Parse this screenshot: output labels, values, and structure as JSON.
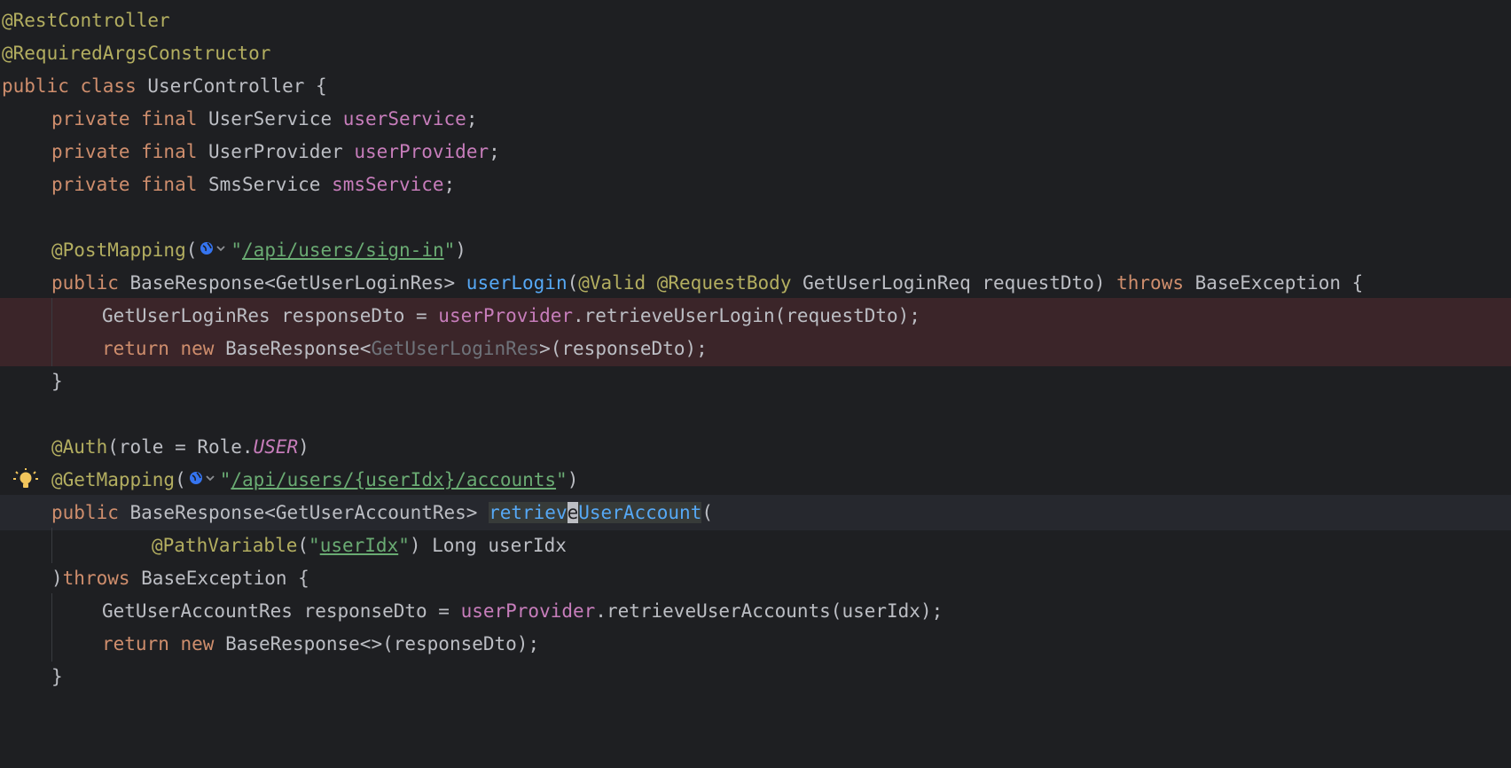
{
  "editor": {
    "colors": {
      "background": "#1e1f22",
      "highlight_line": "#3b2529",
      "keyword": "#cf8e6d",
      "annotation": "#b3ae60",
      "field": "#c77dbb",
      "method": "#56a8f5",
      "string": "#6aab73"
    },
    "code": {
      "l1_ann": "@RestController",
      "l2_ann": "@RequiredArgsConstructor",
      "l3_kw": "public class",
      "l3_rest": " UserController {",
      "l4_kw": "private final",
      "l4_type": " UserService ",
      "l4_field": "userService",
      "l4_end": ";",
      "l5_kw": "private final",
      "l5_type": " UserProvider ",
      "l5_field": "userProvider",
      "l5_end": ";",
      "l6_kw": "private final",
      "l6_type": " SmsService ",
      "l6_field": "smsService",
      "l6_end": ";",
      "l8_ann": "@PostMapping",
      "l8_paren": "(",
      "l8_q1": "\"",
      "l8_url": "/api/users/sign-in",
      "l8_q2": "\"",
      "l8_end": ")",
      "l9_kw": "public",
      "l9_type": " BaseResponse<GetUserLoginRes> ",
      "l9_method": "userLogin",
      "l9_paren": "(",
      "l9_ann": "@Valid @RequestBody",
      "l9_params": " GetUserLoginReq requestDto) ",
      "l9_throws": "throws",
      "l9_end": " BaseException {",
      "l10_decl": "GetUserLoginRes responseDto = ",
      "l10_field": "userProvider",
      "l10_call": ".retrieveUserLogin(requestDto);",
      "l11_kw": "return new",
      "l11_type": " BaseResponse<",
      "l11_dim": "GetUserLoginRes",
      "l11_end": ">(responseDto);",
      "l12_brace": "}",
      "l14_ann": "@Auth",
      "l14_mid": "(role = Role.",
      "l14_enum": "USER",
      "l14_end": ")",
      "l15_ann": "@GetMapping",
      "l15_paren": "(",
      "l15_q1": "\"",
      "l15_url": "/api/users/{userIdx}/accounts",
      "l15_q2": "\"",
      "l15_end": ")",
      "l16_kw": "public",
      "l16_type": " BaseResponse<GetUserAccountRes> ",
      "l16_m1": "retriev",
      "l16_caret": "e",
      "l16_m2": "UserAccount",
      "l16_end": "(",
      "l17_ann": "@PathVariable",
      "l17_paren": "(",
      "l17_q1": "\"",
      "l17_str": "userIdx",
      "l17_q2": "\"",
      "l17_end": ") Long userIdx",
      "l18_paren": ")",
      "l18_throws": "throws",
      "l18_end": " BaseException {",
      "l19_decl": "GetUserAccountRes responseDto = ",
      "l19_field": "userProvider",
      "l19_call": ".retrieveUserAccounts(userIdx);",
      "l20_kw": "return new",
      "l20_end": " BaseResponse<>(responseDto);",
      "l21_brace": "}"
    }
  }
}
